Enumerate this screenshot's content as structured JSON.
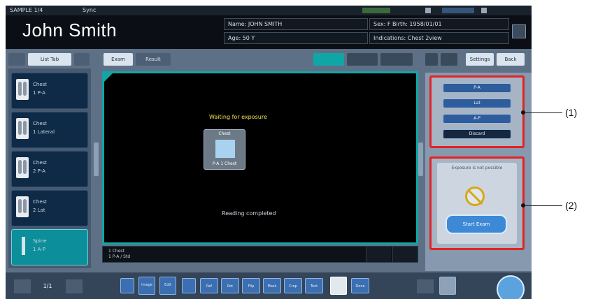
{
  "header": {
    "status_left": "SAMPLE 1/4",
    "status_mid": "Sync",
    "patient_name": "John Smith",
    "info_row1_left": "Name: JOHN SMITH",
    "info_row1_right": "Sex: F   Birth: 1958/01/01",
    "info_row2_left": "Age: 50 Y",
    "info_row2_right": "Indications: Chest 2view"
  },
  "tabs": {
    "left": [
      "",
      "List Tab",
      ""
    ],
    "center": [
      "Exam",
      "Result"
    ],
    "view_modes": [
      "",
      "",
      ""
    ],
    "right": [
      "",
      "",
      "Settings",
      "Back"
    ]
  },
  "sidebar": {
    "items": [
      {
        "line1": "Chest",
        "line2": "1 P-A"
      },
      {
        "line1": "Chest",
        "line2": "1 Lateral"
      },
      {
        "line1": "Chest",
        "line2": "2 P-A"
      },
      {
        "line1": "Chest",
        "line2": "2 Lat"
      },
      {
        "line1": "Spine",
        "line2": "1 A-P"
      }
    ]
  },
  "viewer": {
    "waiting_label": "Waiting for exposure",
    "exam_icon_top": "Chest",
    "exam_icon_bottom": "P-A  1 Chest",
    "status": "Reading completed",
    "footer_line1": "1 Chest",
    "footer_line2": "1 P-A / Std"
  },
  "right_panel": {
    "buttons": [
      "P-A",
      "Lat",
      "A-P",
      "Discard"
    ],
    "message": "Exposure is not possible",
    "cta": "Start Exam"
  },
  "callouts": {
    "c1": "(1)",
    "c2": "(2)"
  },
  "toolbar": {
    "page_indicator": "1/1",
    "buttons": [
      "",
      "Image",
      "Edit",
      "",
      "Ref",
      "Rot",
      "Flip",
      "Mask",
      "Crop",
      "Text",
      "",
      "Done",
      "",
      ""
    ]
  }
}
